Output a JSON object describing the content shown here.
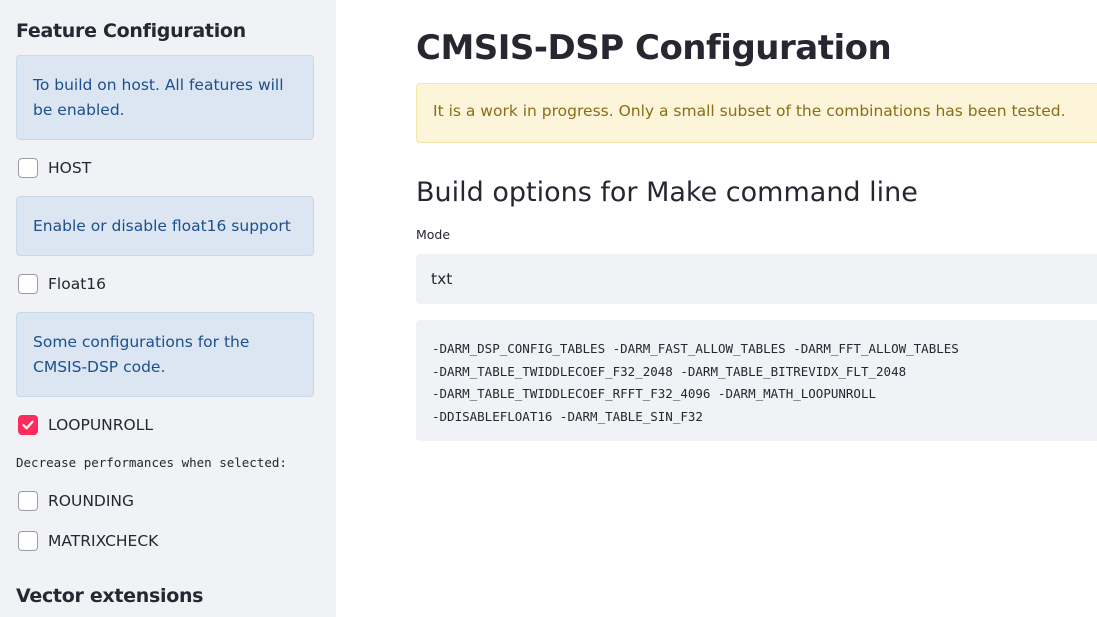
{
  "sidebar": {
    "heading": "Feature Configuration",
    "info_host": "To build on host. All features will be enabled.",
    "host": {
      "label": "HOST",
      "checked": false
    },
    "info_float16": "Enable or disable float16 support",
    "float16": {
      "label": "Float16",
      "checked": false
    },
    "info_configs": "Some configurations for the CMSIS-DSP code.",
    "loopunroll": {
      "label": "LOOPUNROLL",
      "checked": true
    },
    "perf_note": "Decrease performances when selected:",
    "rounding": {
      "label": "ROUNDING",
      "checked": false
    },
    "matrixcheck": {
      "label": "MATRIXCHECK",
      "checked": false
    },
    "vector_heading": "Vector extensions"
  },
  "main": {
    "title": "CMSIS-DSP Configuration",
    "warning": "It is a work in progress. Only a small subset of the combinations has been tested.",
    "subtitle": "Build options for Make command line",
    "mode_label": "Mode",
    "mode_value": "txt",
    "code_lines": [
      "-DARM_DSP_CONFIG_TABLES -DARM_FAST_ALLOW_TABLES -DARM_FFT_ALLOW_TABLES",
      "-DARM_TABLE_TWIDDLECOEF_F32_2048 -DARM_TABLE_BITREVIDX_FLT_2048",
      "-DARM_TABLE_TWIDDLECOEF_RFFT_F32_4096 -DARM_MATH_LOOPUNROLL",
      "-DDISABLEFLOAT16 -DARM_TABLE_SIN_F32"
    ]
  },
  "colors": {
    "accent": "#ff2b5e",
    "info_bg": "#dbe6f2",
    "warning_bg": "#fdf5d9"
  }
}
